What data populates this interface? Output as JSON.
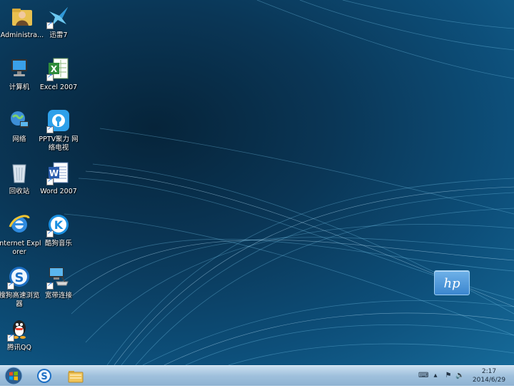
{
  "desktop": {
    "icons": [
      {
        "label": "Administra...",
        "icon": "user-folder-icon"
      },
      {
        "label": "迅雷7",
        "icon": "thunder-icon"
      },
      {
        "label": "计算机",
        "icon": "computer-icon"
      },
      {
        "label": "Excel 2007",
        "icon": "excel-icon"
      },
      {
        "label": "网络",
        "icon": "network-icon"
      },
      {
        "label": "PPTV聚力 网络电视",
        "icon": "pptv-icon"
      },
      {
        "label": "回收站",
        "icon": "recycle-bin-icon"
      },
      {
        "label": "Word 2007",
        "icon": "word-icon"
      },
      {
        "label": "Internet Explorer",
        "icon": "internet-explorer-icon"
      },
      {
        "label": "酷狗音乐",
        "icon": "kugou-icon"
      },
      {
        "label": "搜狗高速浏览器",
        "icon": "sogou-browser-icon"
      },
      {
        "label": "宽带连接",
        "icon": "broadband-connection-icon"
      },
      {
        "label": "腾讯QQ",
        "icon": "qq-icon"
      }
    ],
    "wallpaper_logo": "hp"
  },
  "taskbar": {
    "pinned": [
      {
        "name": "sogou-browser",
        "icon": "sogou-browser-icon"
      },
      {
        "name": "file-explorer",
        "icon": "folder-icon"
      }
    ],
    "clock": {
      "time": "2:17",
      "date": "2014/6/29"
    }
  }
}
